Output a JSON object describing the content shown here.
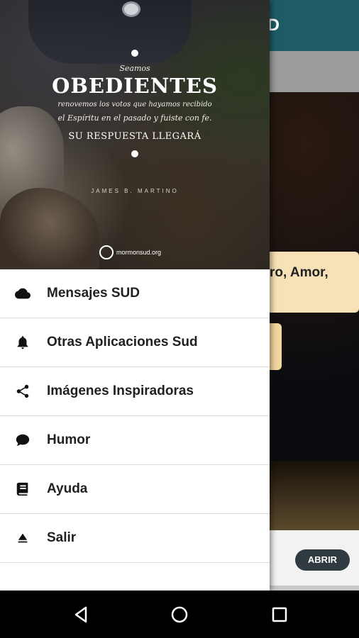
{
  "background_app": {
    "title_fragment": "D",
    "card_text": "ro, Amor,",
    "open_button_label": "ABRIR"
  },
  "drawer": {
    "header": {
      "line_top": "Seamos",
      "line_big": "OBEDIENTES",
      "line_sub1": "renovemos los votos que hayamos recibido",
      "line_sub2": "el Espíritu en el pasado y fuiste con fe.",
      "line_answer": "SU RESPUESTA LLEGARÁ",
      "author": "JAMES B. MARTINO",
      "logo_text": "mormonsud.org"
    },
    "items": [
      {
        "label": "Mensajes SUD",
        "icon": "cloud-icon"
      },
      {
        "label": "Otras Aplicaciones Sud",
        "icon": "bell-icon"
      },
      {
        "label": "Imágenes Inspiradoras",
        "icon": "share-icon"
      },
      {
        "label": "Humor",
        "icon": "chat-bubble-icon"
      },
      {
        "label": "Ayuda",
        "icon": "book-icon"
      },
      {
        "label": "Salir",
        "icon": "eject-icon"
      }
    ]
  },
  "navbar": {
    "buttons": [
      "back",
      "home",
      "recents"
    ]
  },
  "colors": {
    "appbar": "#1d5c66",
    "card": "#f7e2b7",
    "open_button": "#2f3b40"
  }
}
